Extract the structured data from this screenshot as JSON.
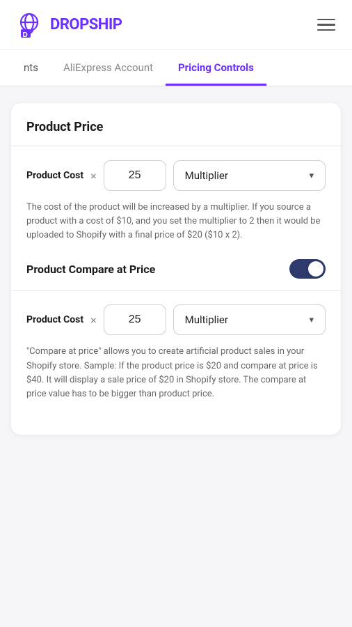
{
  "header": {
    "logo_letter": "D",
    "logo_name": "ROPSHIP"
  },
  "tabs": [
    {
      "id": "nts",
      "label": "nts",
      "active": false,
      "partial": true
    },
    {
      "id": "aliexpress",
      "label": "AliExpress Account",
      "active": false,
      "partial": false
    },
    {
      "id": "pricing",
      "label": "Pricing Controls",
      "active": true,
      "partial": false
    }
  ],
  "product_price_section": {
    "title": "Product Price",
    "cost_label": "Product Cost",
    "multiply_sign": "×",
    "input_value": "25",
    "dropdown_label": "Multiplier",
    "description": "The cost of the product will be increased by a multiplier. If you source a product with a cost of $10, and you set the multiplier to 2 then it would be uploaded to Shopify with a final price of $20 ($10 x 2)."
  },
  "compare_price_section": {
    "title": "Product Compare at Price",
    "toggle_on": true,
    "cost_label": "Product Cost",
    "multiply_sign": "×",
    "input_value": "25",
    "dropdown_label": "Multiplier",
    "description": "\"Compare at price\" allows you to create artificial product sales in your Shopify store. Sample: If the product price is $20 and compare at price is $40. It will display a sale price of $20 in Shopify store. The compare at price value has to be bigger than product price."
  }
}
